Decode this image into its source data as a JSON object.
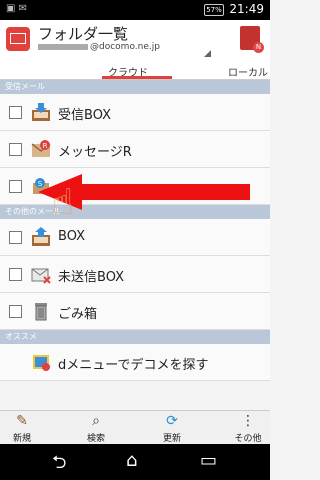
{
  "status": {
    "battery": "57%",
    "time": "21:49"
  },
  "header": {
    "title": "フォルダ一覧",
    "account": "@docomo.ne.jp"
  },
  "tabs": [
    {
      "label": "クラウド",
      "selected": true
    },
    {
      "label": "ローカル",
      "selected": false
    }
  ],
  "sections": {
    "inbox": "受信メール",
    "other": "その他のメール",
    "recommend": "オススメ"
  },
  "rows": {
    "inbox_box": "受信BOX",
    "message_r": "メッセージR",
    "s_folder": "",
    "outbox": "BOX",
    "unsent": "未送信BOX",
    "trash": "ごみ箱",
    "dmenu": "dメニューでデコメを探す"
  },
  "bottom": {
    "new": "新規",
    "search": "検索",
    "update": "更新",
    "other": "その他"
  },
  "colors": {
    "accent": "#e0413c",
    "section_bg": "#b9c7d8",
    "arrow": "#ee1111"
  }
}
